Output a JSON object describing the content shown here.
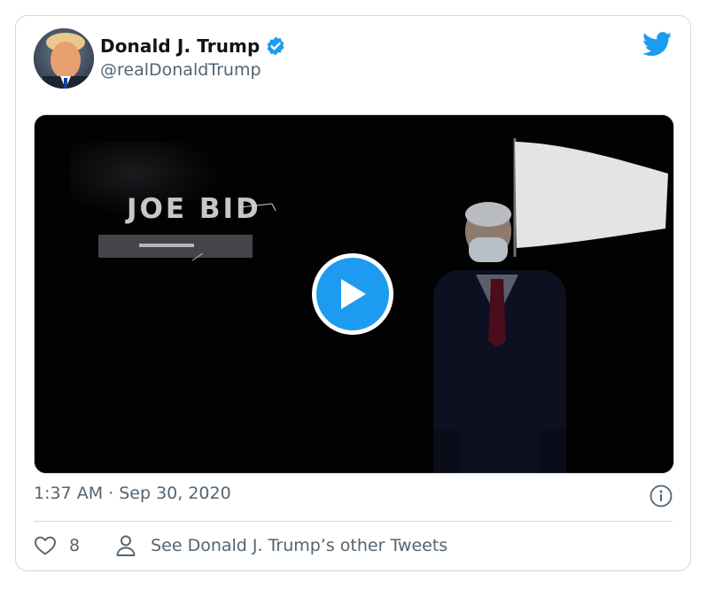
{
  "author": {
    "display_name": "Donald J. Trump",
    "handle": "@realDonaldTrump",
    "verified": true
  },
  "media": {
    "type": "video",
    "caption_overlay": "JOE BID"
  },
  "timestamp": "1:37 AM · Sep 30, 2020",
  "actions": {
    "like_count": "8",
    "see_more_label": "See Donald J. Trump’s other Tweets"
  },
  "colors": {
    "brand": "#1d9bf0",
    "verified": "#1d9bf0",
    "secondary_text": "#536471",
    "border": "#cfd9de"
  },
  "icons": [
    "verified-badge-icon",
    "twitter-bird-icon",
    "play-icon",
    "info-icon",
    "heart-icon",
    "person-icon"
  ]
}
